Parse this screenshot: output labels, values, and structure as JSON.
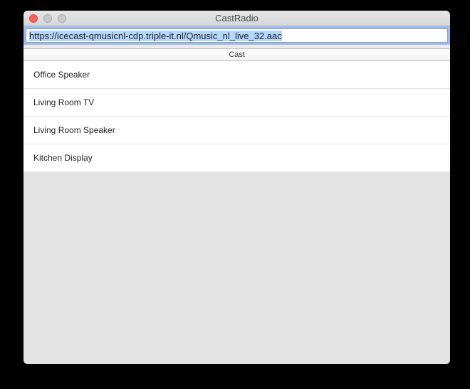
{
  "window": {
    "title": "CastRadio"
  },
  "toolbar": {
    "url_value": "https://icecast-qmusicnl-cdp.triple-it.nl/Qmusic_nl_live_32.aac"
  },
  "cast": {
    "header": "Cast",
    "devices": [
      {
        "name": "Office Speaker"
      },
      {
        "name": "Living Room TV"
      },
      {
        "name": "Living Room Speaker"
      },
      {
        "name": "Kitchen Display"
      }
    ]
  }
}
